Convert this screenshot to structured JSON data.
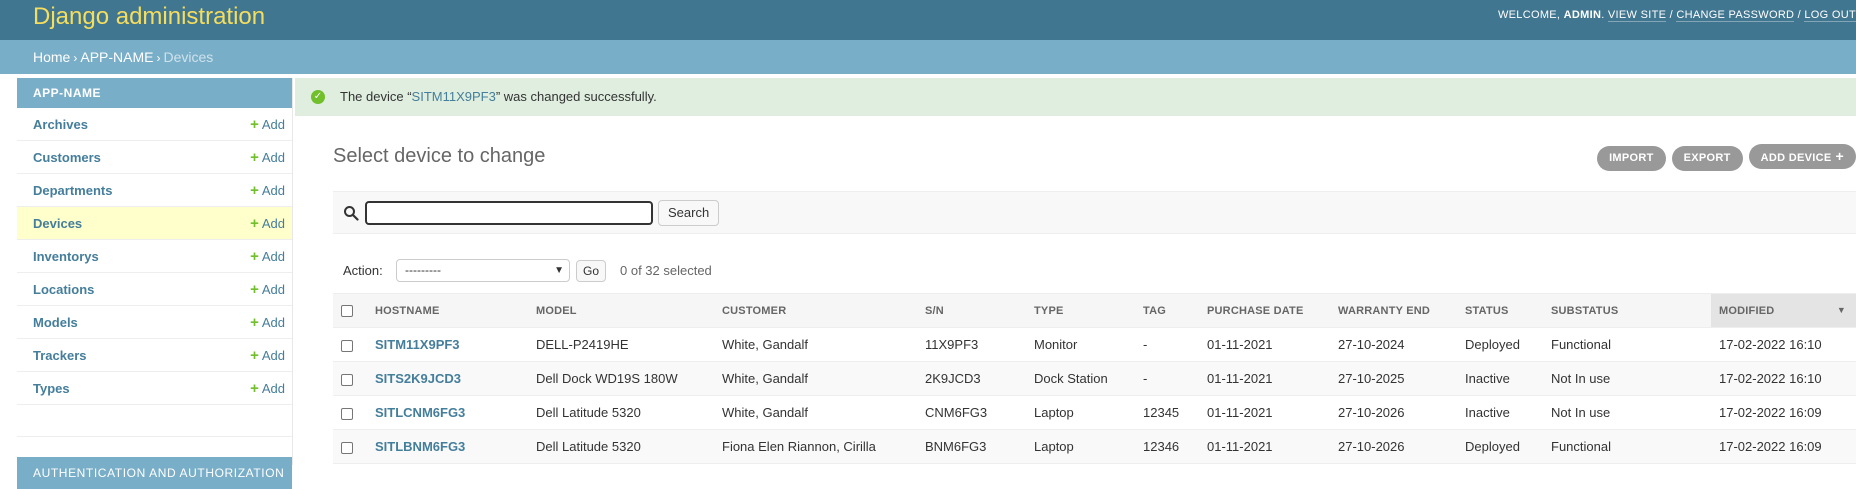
{
  "header": {
    "branding": "Django administration",
    "welcome": "WELCOME,",
    "username": "ADMIN",
    "view_site": "VIEW SITE",
    "change_password": "CHANGE PASSWORD",
    "log_out": "LOG OUT",
    "separator": "/"
  },
  "breadcrumbs": {
    "home": "Home",
    "app": "APP-NAME",
    "current": "Devices",
    "sep": "›"
  },
  "sidebar": {
    "app_caption": "APP-NAME",
    "add_label": "Add",
    "items": [
      {
        "label": "Archives"
      },
      {
        "label": "Customers"
      },
      {
        "label": "Departments"
      },
      {
        "label": "Devices"
      },
      {
        "label": "Inventorys"
      },
      {
        "label": "Locations"
      },
      {
        "label": "Models"
      },
      {
        "label": "Trackers"
      },
      {
        "label": "Types"
      }
    ],
    "auth_caption": "AUTHENTICATION AND AUTHORIZATION"
  },
  "message": {
    "prefix": "The device “",
    "link": "SITM11X9PF3",
    "suffix": "” was changed successfully."
  },
  "page": {
    "title": "Select device to change"
  },
  "object_tools": {
    "import": "IMPORT",
    "export": "EXPORT",
    "add": "ADD DEVICE"
  },
  "search": {
    "value": "",
    "button": "Search"
  },
  "actions": {
    "label": "Action:",
    "selected_option": "---------",
    "go": "Go",
    "counter": "0 of 32 selected"
  },
  "table": {
    "columns": [
      "HOSTNAME",
      "MODEL",
      "CUSTOMER",
      "S/N",
      "TYPE",
      "TAG",
      "PURCHASE DATE",
      "WARRANTY END",
      "STATUS",
      "SUBSTATUS",
      "MODIFIED"
    ],
    "rows": [
      [
        "SITM11X9PF3",
        "DELL-P2419HE",
        "White, Gandalf",
        "11X9PF3",
        "Monitor",
        "-",
        "01-11-2021",
        "27-10-2024",
        "Deployed",
        "Functional",
        "17-02-2022 16:10"
      ],
      [
        "SITS2K9JCD3",
        "Dell Dock WD19S 180W",
        "White, Gandalf",
        "2K9JCD3",
        "Dock Station",
        "-",
        "01-11-2021",
        "27-10-2025",
        "Inactive",
        "Not In use",
        "17-02-2022 16:10"
      ],
      [
        "SITLCNM6FG3",
        "Dell Latitude 5320",
        "White, Gandalf",
        "CNM6FG3",
        "Laptop",
        "12345",
        "01-11-2021",
        "27-10-2026",
        "Inactive",
        "Not In use",
        "17-02-2022 16:09"
      ],
      [
        "SITLBNM6FG3",
        "Dell Latitude 5320",
        "Fiona Elen Riannon, Cirilla",
        "BNM6FG3",
        "Laptop",
        "12346",
        "01-11-2021",
        "27-10-2026",
        "Deployed",
        "Functional",
        "17-02-2022 16:09"
      ]
    ]
  },
  "colors": {
    "header_bg": "#417690",
    "branding": "#f5dd5d",
    "breadcrumb_bg": "#79aec8",
    "link": "#447e9b",
    "add_plus": "#70bf2b",
    "success_bg": "#dfeedf",
    "current_row": "#ffffcc"
  }
}
